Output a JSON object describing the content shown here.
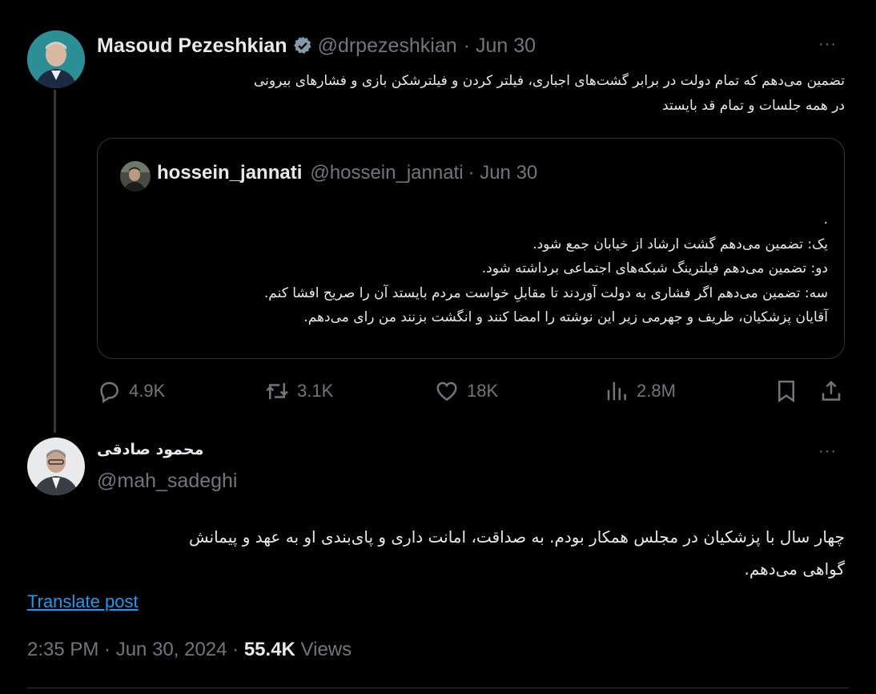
{
  "original_tweet": {
    "author_name": "Masoud Pezeshkian",
    "handle": "@drpezeshkian",
    "date": "· Jun 30",
    "text_line1": "تضمین می‌دهم که تمام دولت در برابر  گشت‌های اجباری، فیلتر کردن و فیلترشکن بازی و فشارهای بیرونی",
    "text_line2": "در همه جلسات و تمام قد بایستد",
    "quoted": {
      "author_name": "hossein_jannati",
      "handle": "@hossein_jannati",
      "date": "· Jun 30",
      "lines": [
        ".",
        "یک: تضمین می‌دهم گشت ارشاد از خیابان جمع شود.",
        "دو: تضمین می‌دهم فیلترینگ شبکه‌های اجتماعی برداشته شود.",
        "سه: تضمین می‌دهم اگر فشاری به دولت آوردند تا مقابلِ خواست مردم بایستد آن را صریح افشا کنم.",
        "آقایان پزشکیان، ظریف و جهرمی زیر این نوشته را امضا کنند و انگشت بزنند من رای می‌دهم."
      ]
    },
    "stats": {
      "replies": "4.9K",
      "reposts": "3.1K",
      "likes": "18K",
      "views": "2.8M"
    }
  },
  "reply_tweet": {
    "author_name": "محمود صادقی",
    "handle": "@mah_sadeghi",
    "text_line1": "چهار سال با پزشکیان در مجلس همکار بودم. به صداقت، امانت داری و پای‌بندی او به عهد و پیمانش",
    "text_line2": "گواهی می‌دهم.",
    "translate_label": "Translate post",
    "time": "2:35 PM · Jun 30, 2024 · ",
    "views_count": "55.4K",
    "views_label": " Views"
  },
  "more_glyph": "···",
  "colors": {
    "background": "#000000",
    "text": "#e7e9ea",
    "muted": "#71767b",
    "link": "#1d9bf0",
    "verified": "#829aab"
  },
  "icons": [
    "reply-icon",
    "repost-icon",
    "like-icon",
    "views-icon",
    "bookmark-icon",
    "share-icon",
    "verified-icon",
    "more-icon"
  ]
}
